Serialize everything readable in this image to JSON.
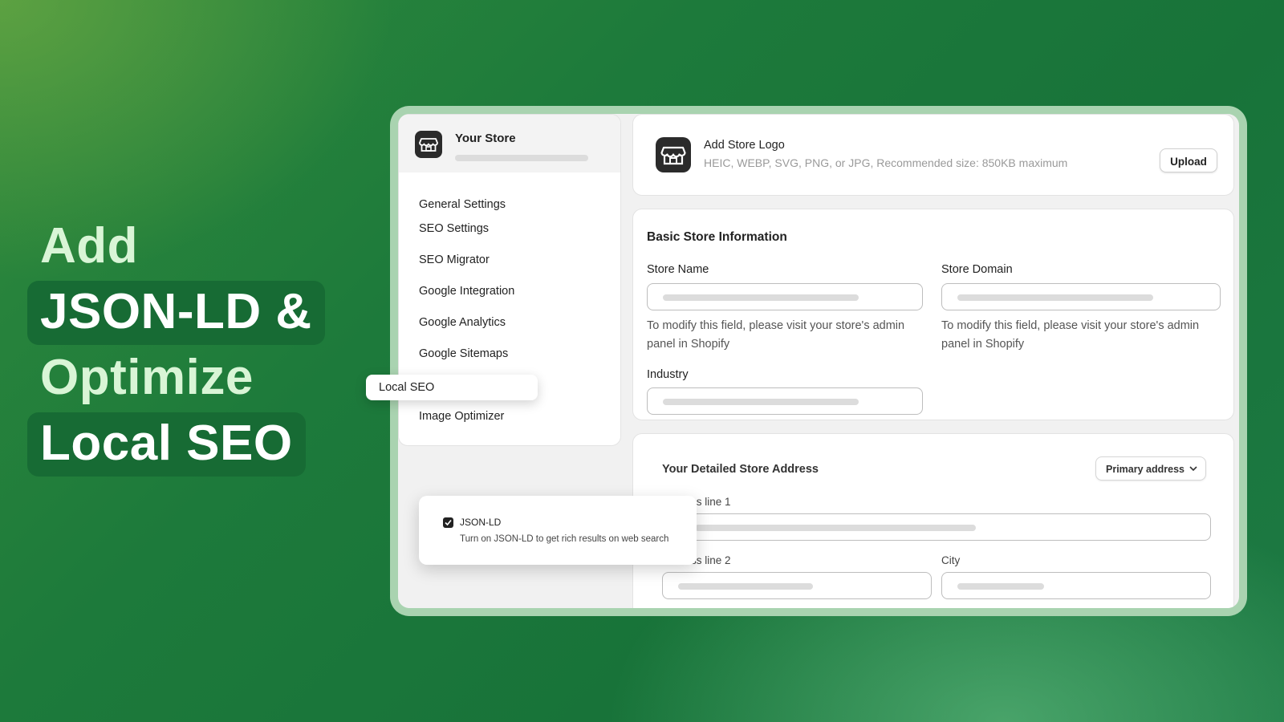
{
  "hero": {
    "line1": "Add",
    "line2": "JSON-LD &",
    "line3": "Optimize",
    "line4": "Local SEO"
  },
  "sidebar": {
    "store_name": "Your Store",
    "items": [
      {
        "label": "General Settings"
      },
      {
        "label": "SEO Settings"
      },
      {
        "label": "SEO Migrator"
      },
      {
        "label": "Google Integration"
      },
      {
        "label": "Google Analytics"
      },
      {
        "label": "Google Sitemaps"
      },
      {
        "label": "Local SEO",
        "active": true
      },
      {
        "label": "Image Optimizer"
      }
    ]
  },
  "popover": {
    "checked": true,
    "title": "JSON-LD",
    "description": "Turn on JSON-LD to get rich results on web search"
  },
  "logo_card": {
    "title": "Add Store Logo",
    "hint": "HEIC, WEBP, SVG, PNG, or JPG, Recommended size: 850KB maximum",
    "upload_label": "Upload"
  },
  "basic_info": {
    "title": "Basic Store Information",
    "store_name_label": "Store Name",
    "store_domain_label": "Store Domain",
    "help_text": "To modify this field, please visit your store's admin panel in Shopify",
    "industry_label": "Industry"
  },
  "address": {
    "title": "Your Detailed Store Address",
    "dropdown_value": "Primary address",
    "address_line1_label": "Address line 1",
    "address_line2_label": "Address line 2",
    "city_label": "City"
  },
  "colors": {
    "background": "#1d7a3b",
    "accent_pill": "#176b34",
    "frame": "#a9d3b0"
  }
}
